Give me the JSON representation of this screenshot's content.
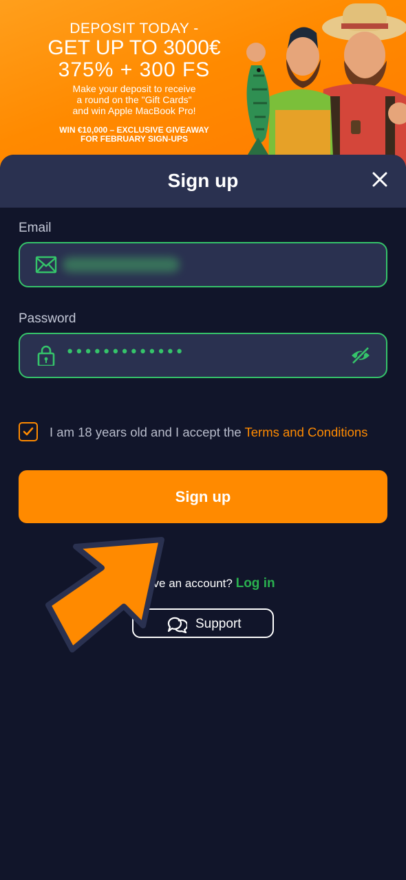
{
  "banner": {
    "line1": "DEPOSIT TODAY -",
    "line2": "GET UP TO 3000€",
    "line3": "375% + 300 FS",
    "line4": "Make your deposit to receive\na round on the \"Gift Cards\"\nand win Apple MacBook Pro!",
    "line5": "WIN €10,000 – EXCLUSIVE GIVEAWAY\nFOR FEBRUARY SIGN-UPS",
    "background_color": "#ff8a00"
  },
  "modal": {
    "title": "Sign up",
    "close_icon": "close-icon"
  },
  "form": {
    "email_label": "Email",
    "email_icon": "envelope-icon",
    "password_label": "Password",
    "password_value": "•••••••••••••",
    "password_icon": "lock-icon",
    "toggle_visibility_icon": "eye-off-icon",
    "accent_color": "#35c46a"
  },
  "terms": {
    "checked": true,
    "text": "I am 18 years old and I accept the ",
    "link": "Terms and Conditions"
  },
  "signup_button": {
    "label": "Sign up",
    "color": "#ff8a00"
  },
  "footer": {
    "account_text": "y have an account?",
    "login_label": "Log in",
    "support_label": "Support",
    "support_icon": "chat-bubbles-icon"
  },
  "annotation": {
    "pointer_icon": "arrow-pointer-icon",
    "color": "#ff8a00"
  }
}
